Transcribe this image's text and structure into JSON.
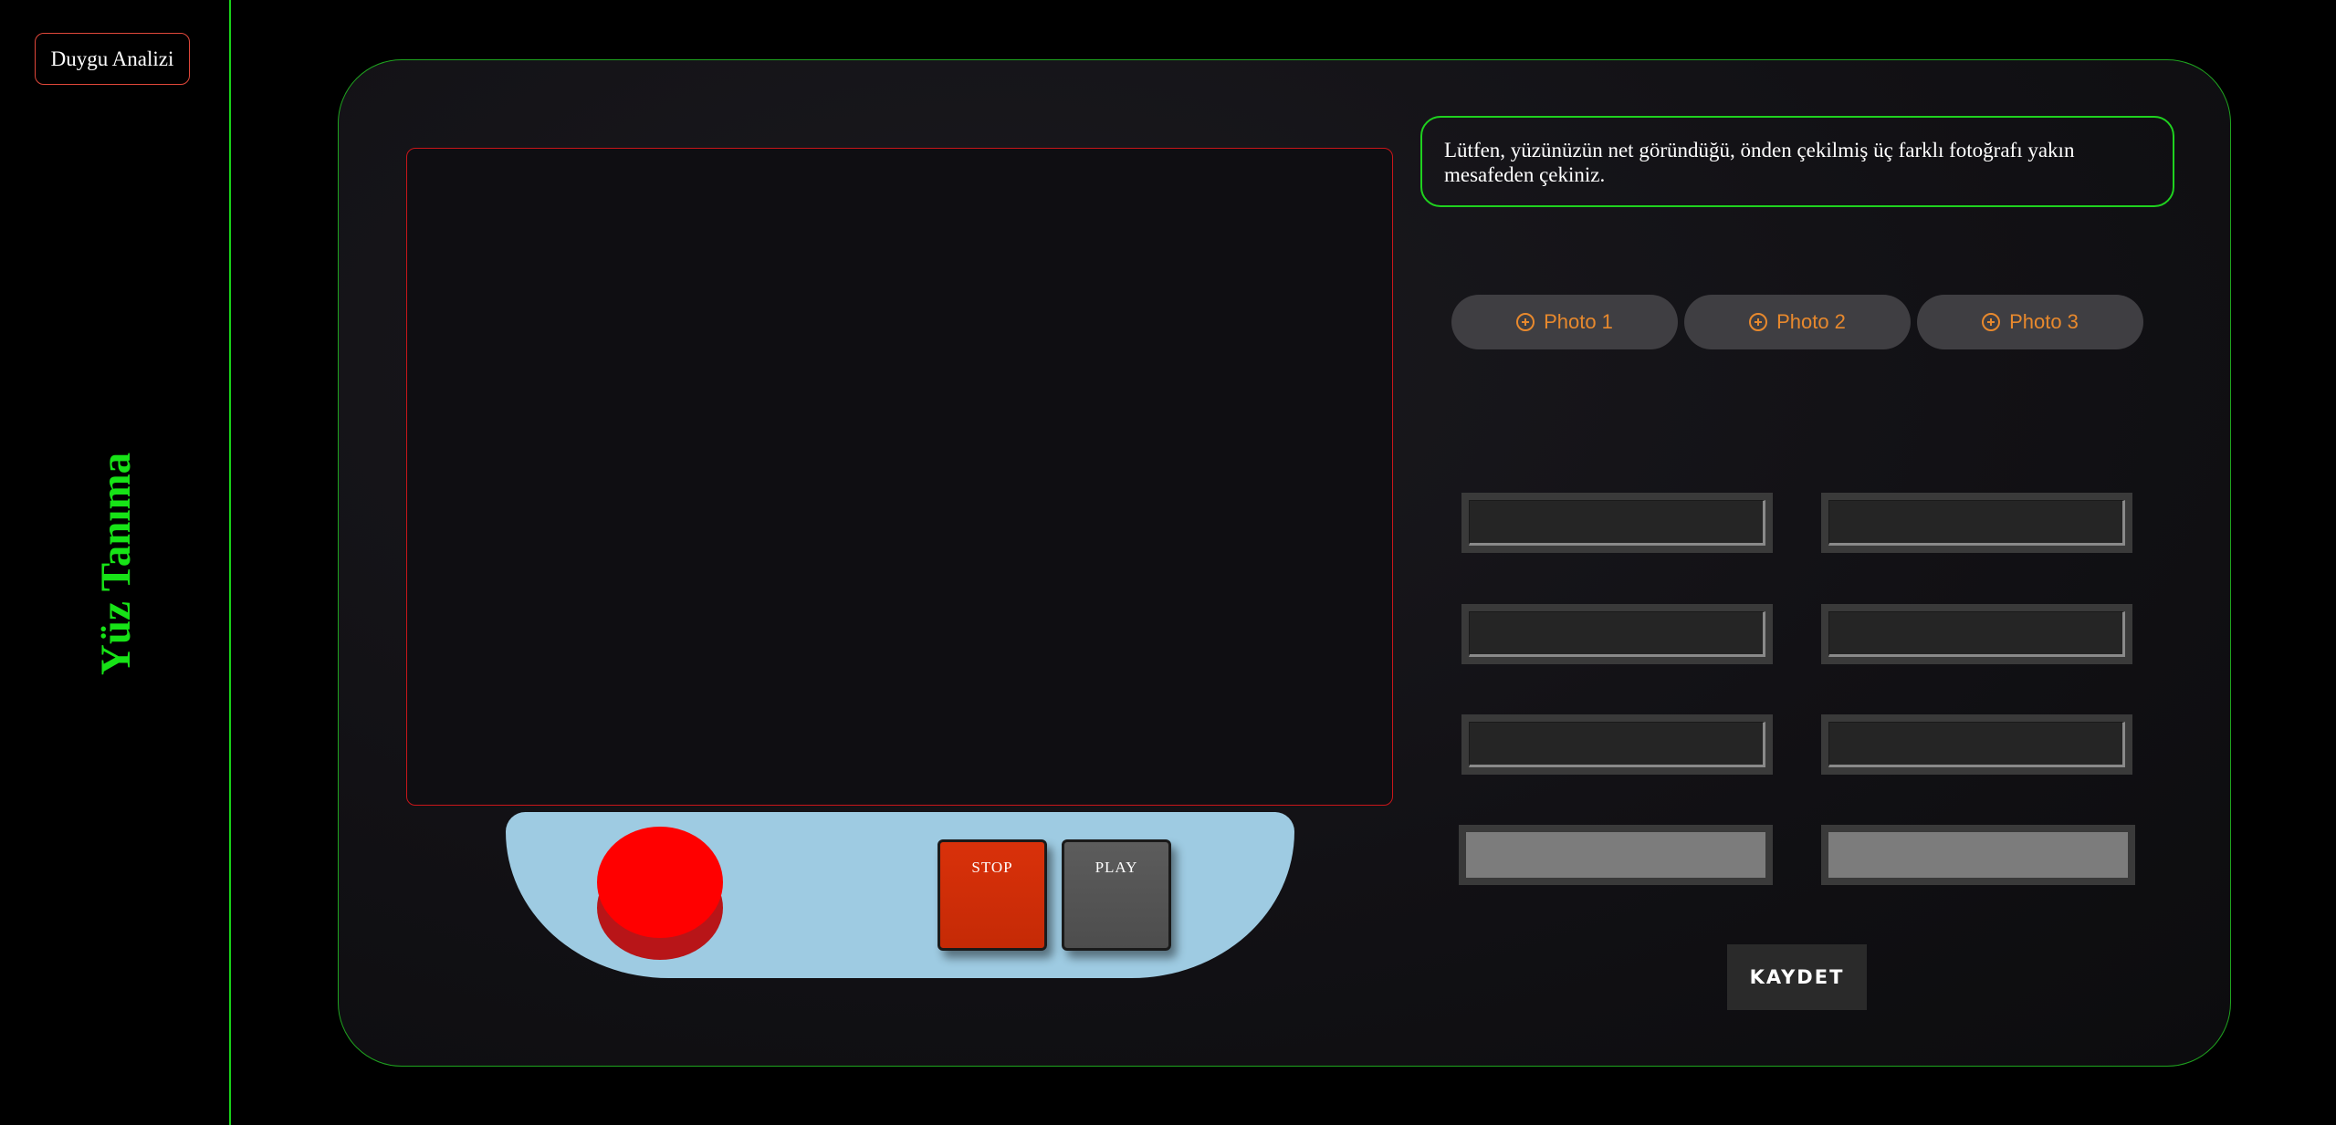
{
  "sidebar": {
    "nav_button": "Duygu Analizi",
    "title": "Yüz Tanıma"
  },
  "camera": {
    "stop_label": "STOP",
    "play_label": "PLAY"
  },
  "instruction": "Lütfen, yüzünüzün net göründüğü, önden çekilmiş üç farklı fotoğrafı yakın mesafeden çekiniz.",
  "photos": [
    {
      "label": "Photo 1"
    },
    {
      "label": "Photo 2"
    },
    {
      "label": "Photo 3"
    }
  ],
  "save_label": "KAYDET",
  "colors": {
    "accent_green": "#19d119",
    "frame_red": "#c8161a",
    "record_red": "#ff0000",
    "stop_orange": "#d9310a",
    "photo_text": "#e8892d",
    "controls_bg": "#9ecbe2"
  },
  "icons": {
    "photo_add": "circle-plus-icon"
  }
}
